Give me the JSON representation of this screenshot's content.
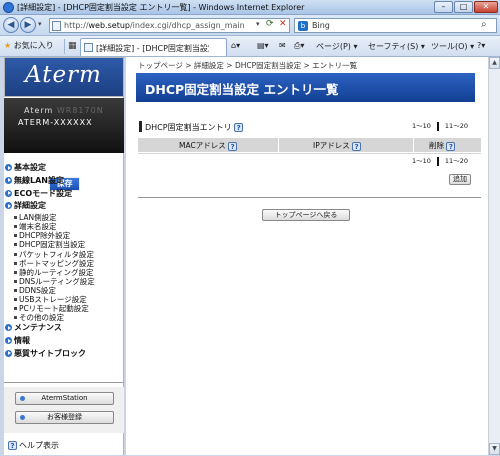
{
  "window": {
    "title": "[詳細設定] - [DHCP固定割当設定 エントリ一覧] - Windows Internet Explorer",
    "minimize_label": "–",
    "maximize_label": "□",
    "close_label": "✕"
  },
  "address": {
    "url_prefix": "http://",
    "url_host": "web.setup",
    "url_path": "/index.cgi/dhcp_assign_main",
    "search_placeholder": "Bing"
  },
  "commands": {
    "favorites_label": "お気に入り",
    "tab_label": "[詳細設定] - [DHCP固定割当設定 エ...",
    "page_label": "ページ(P) ▾",
    "safety_label": "セーフティ(S) ▾",
    "tools_label": "ツール(O) ▾",
    "help_icon_label": "?▾"
  },
  "sidebar": {
    "logo": "Aterm",
    "device_model_prefix": "Aterm ",
    "device_model_hidden": "WR8170N",
    "device_id": "ATERM-XXXXXX",
    "save_label": "保存",
    "menu": [
      {
        "label": "基本設定"
      },
      {
        "label": "無線LAN設定"
      },
      {
        "label": "ECOモード設定"
      },
      {
        "label": "詳細設定"
      }
    ],
    "sub_menu": [
      "LAN側設定",
      "端末名設定",
      "DHCP除外設定",
      "DHCP固定割当設定",
      "パケットフィルタ設定",
      "ポートマッピング設定",
      "静的ルーティング設定",
      "DNSルーティング設定",
      "DDNS設定",
      "USBストレージ設定",
      "PCリモート起動設定",
      "その他の設定"
    ],
    "menu_after": [
      {
        "label": "メンテナンス"
      },
      {
        "label": "情報"
      },
      {
        "label": "悪質サイトブロック"
      }
    ],
    "aterm_station_label": "AtermStation",
    "register_label": "お客様登録",
    "help_label": "ヘルプ表示"
  },
  "main": {
    "breadcrumb": "トップページ > 詳細設定 > DHCP固定割当設定 > エントリ一覧",
    "page_title": "DHCP固定割当設定 エントリ一覧",
    "section_title": "DHCP固定割当エントリ",
    "pager_left": "1～10",
    "pager_right": "11～20",
    "columns": [
      "MACアドレス",
      "IPアドレス",
      "削除"
    ],
    "add_label": "追加",
    "back_to_top_label": "トップページへ戻る"
  }
}
